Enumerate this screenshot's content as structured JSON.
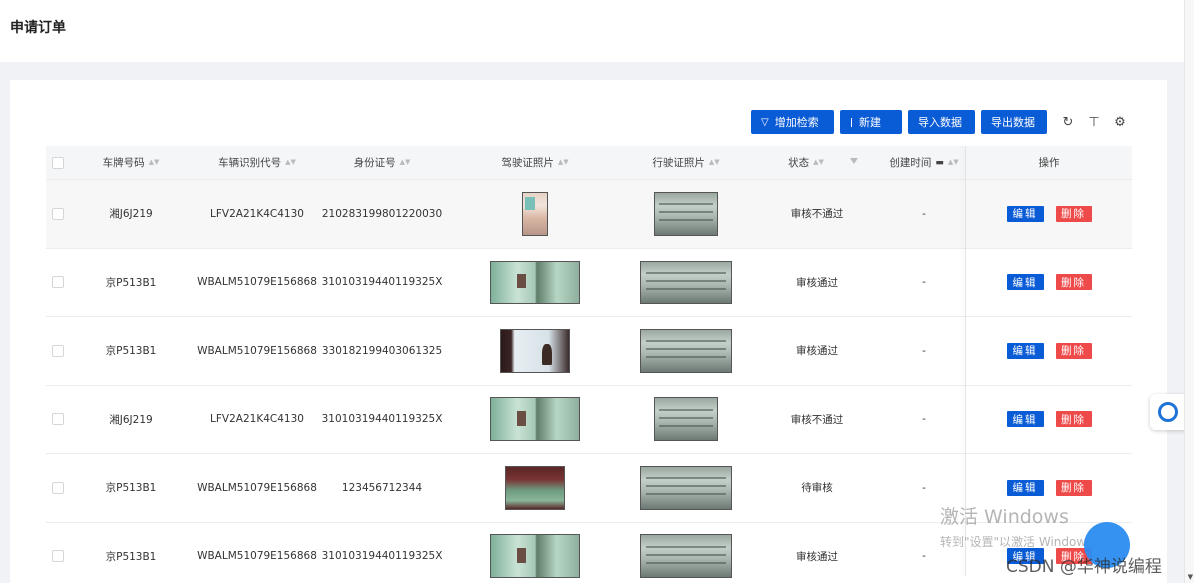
{
  "page": {
    "title": "申请订单"
  },
  "toolbar": {
    "buttons": [
      {
        "label": "增加检索",
        "icon": "filter-icon"
      },
      {
        "label": "新建",
        "icon": "plus-icon"
      },
      {
        "label": "导入数据"
      },
      {
        "label": "导出数据"
      }
    ],
    "icons": [
      "refresh-icon",
      "column-height-icon",
      "settings-icon"
    ]
  },
  "table": {
    "columns": [
      "车牌号码",
      "车辆识别代号",
      "身份证号",
      "驾驶证照片",
      "行驶证照片",
      "状态",
      "创建时间",
      "操作"
    ],
    "actions": {
      "edit": "编辑",
      "delete": "删除"
    },
    "rows": [
      {
        "plate": "湘J6J219",
        "vin": "LFV2A21K4C4130",
        "id": "210283199801220030",
        "status": "审核不通过",
        "created": "-"
      },
      {
        "plate": "京P513B1",
        "vin": "WBALM51079E156868",
        "id": "31010319440119325X",
        "status": "审核通过",
        "created": "-"
      },
      {
        "plate": "京P513B1",
        "vin": "WBALM51079E156868",
        "id": "330182199403061325",
        "status": "审核通过",
        "created": "-"
      },
      {
        "plate": "湘J6J219",
        "vin": "LFV2A21K4C4130",
        "id": "31010319440119325X",
        "status": "审核不通过",
        "created": "-"
      },
      {
        "plate": "京P513B1",
        "vin": "WBALM51079E156868",
        "id": "123456712344",
        "status": "待审核",
        "created": "-"
      },
      {
        "plate": "京P513B1",
        "vin": "WBALM51079E156868",
        "id": "31010319440119325X",
        "status": "审核通过",
        "created": "-"
      }
    ]
  },
  "watermark": {
    "line1": "激活 Windows",
    "line2": "转到\"设置\"以激活 Windows。",
    "csdn": "CSDN @华神说编程"
  }
}
